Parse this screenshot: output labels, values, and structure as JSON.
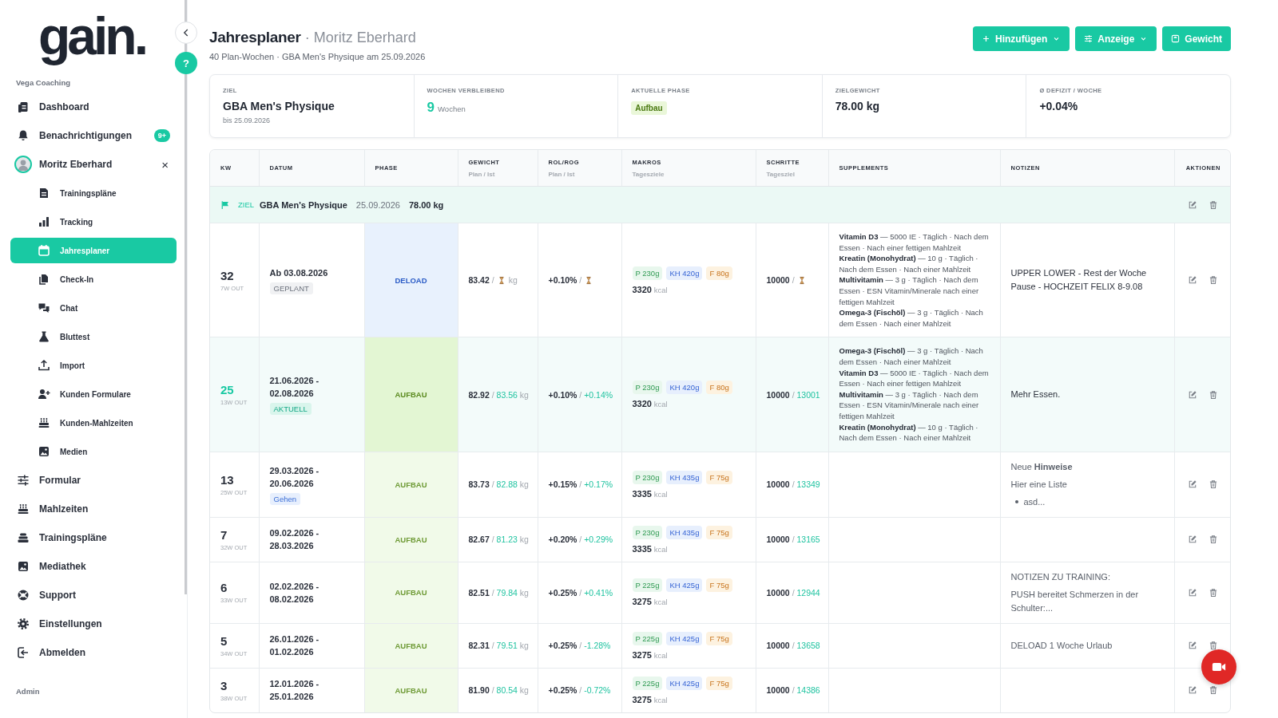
{
  "sidebar": {
    "logo": "gain.",
    "section": "Vega Coaching",
    "footer_section": "Admin",
    "items": [
      {
        "label": "Dashboard",
        "kind": "link",
        "selected": false
      },
      {
        "label": "Benachrichtigungen",
        "kind": "link",
        "badge": "9+",
        "selected": false
      },
      {
        "label": "Moritz Eberhard",
        "kind": "client",
        "close": "×",
        "selected": false,
        "children": [
          {
            "label": "Trainingspläne",
            "selected": false
          },
          {
            "label": "Tracking",
            "selected": false
          },
          {
            "label": "Jahresplaner",
            "selected": true
          },
          {
            "label": "Check-In",
            "selected": false
          },
          {
            "label": "Chat",
            "selected": false
          },
          {
            "label": "Bluttest",
            "selected": false
          },
          {
            "label": "Import",
            "selected": false
          },
          {
            "label": "Kunden Formulare",
            "selected": false
          },
          {
            "label": "Kunden-Mahlzeiten",
            "selected": false
          },
          {
            "label": "Medien",
            "selected": false
          }
        ]
      },
      {
        "label": "Formular",
        "kind": "link",
        "selected": false
      },
      {
        "label": "Mahlzeiten",
        "kind": "link",
        "selected": false
      },
      {
        "label": "Trainingspläne",
        "kind": "link",
        "selected": false
      },
      {
        "label": "Mediathek",
        "kind": "link",
        "selected": false
      },
      {
        "label": "Support",
        "kind": "link",
        "selected": false
      },
      {
        "label": "Einstellungen",
        "kind": "link",
        "selected": false
      },
      {
        "label": "Abmelden",
        "kind": "link",
        "selected": false
      }
    ]
  },
  "help_button": "?",
  "header": {
    "title": "Jahresplaner",
    "subtitle": "· Moritz Eberhard",
    "meta": "40 Plan-Wochen · GBA Men's Physique am 25.09.2026",
    "buttons": [
      {
        "label": "Hinzufügen",
        "dropdown": true
      },
      {
        "label": "Anzeige",
        "dropdown": true
      },
      {
        "label": "Gewicht",
        "dropdown": false
      }
    ]
  },
  "summary": [
    {
      "label": "ZIEL",
      "kind": "text",
      "value": "GBA Men's Physique",
      "sub": "bis 25.09.2026"
    },
    {
      "label": "WOCHEN VERBLEIBEND",
      "kind": "count",
      "value": "9",
      "unit": "Wochen"
    },
    {
      "label": "AKTUELLE PHASE",
      "kind": "badge",
      "value": "Aufbau"
    },
    {
      "label": "ZIELGEWICHT",
      "kind": "text",
      "value": "78.00 kg"
    },
    {
      "label": "Ø DEFIZIT / WOCHE",
      "kind": "text",
      "value": "+0.04%"
    }
  ],
  "table": {
    "separator": "/",
    "columns": [
      {
        "label": "KW"
      },
      {
        "label": "DATUM"
      },
      {
        "label": "PHASE"
      },
      {
        "label": "GEWICHT",
        "sub": "Plan / Ist"
      },
      {
        "label": "ROL/ROG",
        "sub": "Plan / Ist"
      },
      {
        "label": "MAKROS",
        "sub": "Tagesziele"
      },
      {
        "label": "SCHRITTE",
        "sub": "Tagesziel"
      },
      {
        "label": "SUPPLEMENTS"
      },
      {
        "label": "NOTIZEN"
      },
      {
        "label": "AKTIONEN"
      }
    ],
    "goal": {
      "label": "ZIEL",
      "name": "GBA Men's Physique",
      "date": "25.09.2026",
      "weight": "78.00 kg"
    },
    "rows": [
      {
        "kw": "32",
        "out": "7W OUT",
        "current": false,
        "date": "Ab 03.08.2026",
        "status": {
          "label": "GEPLANT",
          "kind": "planned"
        },
        "phase": {
          "label": "DELOAD",
          "kind": "deload"
        },
        "weight": {
          "plan": "83.42",
          "pending": true,
          "unit": "kg"
        },
        "rol": {
          "plan": "+0.10%",
          "pending": true
        },
        "macros": [
          {
            "kind": "protein",
            "text": "P 230g"
          },
          {
            "kind": "carbs",
            "text": "KH 420g"
          },
          {
            "kind": "fat",
            "text": "F 80g"
          }
        ],
        "kcal": "3320",
        "kcal_unit": "kcal",
        "steps": {
          "plan": "10000",
          "pending": true
        },
        "supplements": [
          "**Vitamin D3** — 5000 IE · Täglich · Nach dem Essen · Nach einer fettigen Mahlzeit",
          "**Kreatin (Monohydrat)** — 10 g · Täglich · Nach dem Essen · Nach einer Mahlzeit",
          "**Multivitamin** — 3 g · Täglich · Nach dem Essen · ESN Vitamin/Minerale nach einer fettigen Mahlzeit",
          "**Omega-3 (Fischöl)** — 3 g · Täglich · Nach dem Essen · Nach einer Mahlzeit"
        ],
        "notes": [
          {
            "kind": "text",
            "text": "UPPER LOWER - Rest der Woche Pause - HOCHZEIT FELIX 8-9.08"
          }
        ]
      },
      {
        "kw": "25",
        "out": "13W OUT",
        "current": true,
        "date": "21.06.2026 - 02.08.2026",
        "status": {
          "label": "AKTUELL",
          "kind": "current"
        },
        "phase": {
          "label": "AUFBAU",
          "kind": "aufbau"
        },
        "weight": {
          "plan": "82.92",
          "pending": false,
          "actual": "83.56",
          "unit": "kg"
        },
        "rol": {
          "plan": "+0.10%",
          "pending": false,
          "actual": "+0.14%"
        },
        "macros": [
          {
            "kind": "protein",
            "text": "P 230g"
          },
          {
            "kind": "carbs",
            "text": "KH 420g"
          },
          {
            "kind": "fat",
            "text": "F 80g"
          }
        ],
        "kcal": "3320",
        "kcal_unit": "kcal",
        "steps": {
          "plan": "10000",
          "pending": false,
          "actual": "13001"
        },
        "supplements": [
          "**Omega-3 (Fischöl)** — 3 g · Täglich · Nach dem Essen · Nach einer Mahlzeit",
          "**Vitamin D3** — 5000 IE · Täglich · Nach dem Essen · Nach einer fettigen Mahlzeit",
          "**Multivitamin** — 3 g · Täglich · Nach dem Essen · ESN Vitamin/Minerale nach einer fettigen Mahlzeit",
          "**Kreatin (Monohydrat)** — 10 g · Täglich · Nach dem Essen · Nach einer Mahlzeit"
        ],
        "notes": [
          {
            "kind": "text",
            "text": "Mehr Essen."
          }
        ]
      },
      {
        "kw": "13",
        "out": "25W OUT",
        "current": false,
        "date": "29.03.2026 - 20.06.2026",
        "status": {
          "label": "Gehen",
          "kind": "tag"
        },
        "phase": {
          "label": "AUFBAU",
          "kind": "aufbau"
        },
        "weight": {
          "plan": "83.73",
          "pending": false,
          "actual": "82.88",
          "unit": "kg"
        },
        "rol": {
          "plan": "+0.15%",
          "pending": false,
          "actual": "+0.17%"
        },
        "macros": [
          {
            "kind": "protein",
            "text": "P 230g"
          },
          {
            "kind": "carbs",
            "text": "KH 435g"
          },
          {
            "kind": "fat",
            "text": "F 75g"
          }
        ],
        "kcal": "3335",
        "kcal_unit": "kcal",
        "steps": {
          "plan": "10000",
          "pending": false,
          "actual": "13349"
        },
        "notes": [
          {
            "kind": "text",
            "text": "Neue **Hinweise**"
          },
          {
            "kind": "text",
            "text": "Hier eine Liste"
          },
          {
            "kind": "bullet",
            "text": "asd..."
          }
        ]
      },
      {
        "kw": "7",
        "out": "32W OUT",
        "current": false,
        "date": "09.02.2026 - 28.03.2026",
        "phase": {
          "label": "AUFBAU",
          "kind": "aufbau"
        },
        "weight": {
          "plan": "82.67",
          "pending": false,
          "actual": "81.23",
          "unit": "kg"
        },
        "rol": {
          "plan": "+0.20%",
          "pending": false,
          "actual": "+0.29%"
        },
        "macros": [
          {
            "kind": "protein",
            "text": "P 230g"
          },
          {
            "kind": "carbs",
            "text": "KH 435g"
          },
          {
            "kind": "fat",
            "text": "F 75g"
          }
        ],
        "kcal": "3335",
        "kcal_unit": "kcal",
        "steps": {
          "plan": "10000",
          "pending": false,
          "actual": "13165"
        }
      },
      {
        "kw": "6",
        "out": "33W OUT",
        "current": false,
        "date": "02.02.2026 - 08.02.2026",
        "phase": {
          "label": "AUFBAU",
          "kind": "aufbau"
        },
        "weight": {
          "plan": "82.51",
          "pending": false,
          "actual": "79.84",
          "unit": "kg"
        },
        "rol": {
          "plan": "+0.25%",
          "pending": false,
          "actual": "+0.41%"
        },
        "macros": [
          {
            "kind": "protein",
            "text": "P 225g"
          },
          {
            "kind": "carbs",
            "text": "KH 425g"
          },
          {
            "kind": "fat",
            "text": "F 75g"
          }
        ],
        "kcal": "3275",
        "kcal_unit": "kcal",
        "steps": {
          "plan": "10000",
          "pending": false,
          "actual": "12944"
        },
        "notes": [
          {
            "kind": "text",
            "text": "NOTIZEN ZU TRAINING:"
          },
          {
            "kind": "text",
            "text": "PUSH bereitet Schmerzen in der Schulter:..."
          }
        ]
      },
      {
        "kw": "5",
        "out": "34W OUT",
        "current": false,
        "date": "26.01.2026 - 01.02.2026",
        "phase": {
          "label": "AUFBAU",
          "kind": "aufbau"
        },
        "weight": {
          "plan": "82.31",
          "pending": false,
          "actual": "79.51",
          "unit": "kg"
        },
        "rol": {
          "plan": "+0.25%",
          "pending": false,
          "actual": "-1.28%"
        },
        "macros": [
          {
            "kind": "protein",
            "text": "P 225g"
          },
          {
            "kind": "carbs",
            "text": "KH 425g"
          },
          {
            "kind": "fat",
            "text": "F 75g"
          }
        ],
        "kcal": "3275",
        "kcal_unit": "kcal",
        "steps": {
          "plan": "10000",
          "pending": false,
          "actual": "13658"
        },
        "notes": [
          {
            "kind": "text",
            "text": "DELOAD 1 Woche Urlaub"
          }
        ]
      },
      {
        "kw": "3",
        "out": "38W OUT",
        "current": false,
        "date": "12.01.2026 - 25.01.2026",
        "phase": {
          "label": "AUFBAU",
          "kind": "aufbau"
        },
        "weight": {
          "plan": "81.90",
          "pending": false,
          "actual": "80.54",
          "unit": "kg"
        },
        "rol": {
          "plan": "+0.25%",
          "pending": false,
          "actual": "-0.72%"
        },
        "macros": [
          {
            "kind": "protein",
            "text": "P 225g"
          },
          {
            "kind": "carbs",
            "text": "KH 425g"
          },
          {
            "kind": "fat",
            "text": "F 75g"
          }
        ],
        "kcal": "3275",
        "kcal_unit": "kcal",
        "steps": {
          "plan": "10000",
          "pending": false,
          "actual": "14386"
        }
      }
    ]
  }
}
